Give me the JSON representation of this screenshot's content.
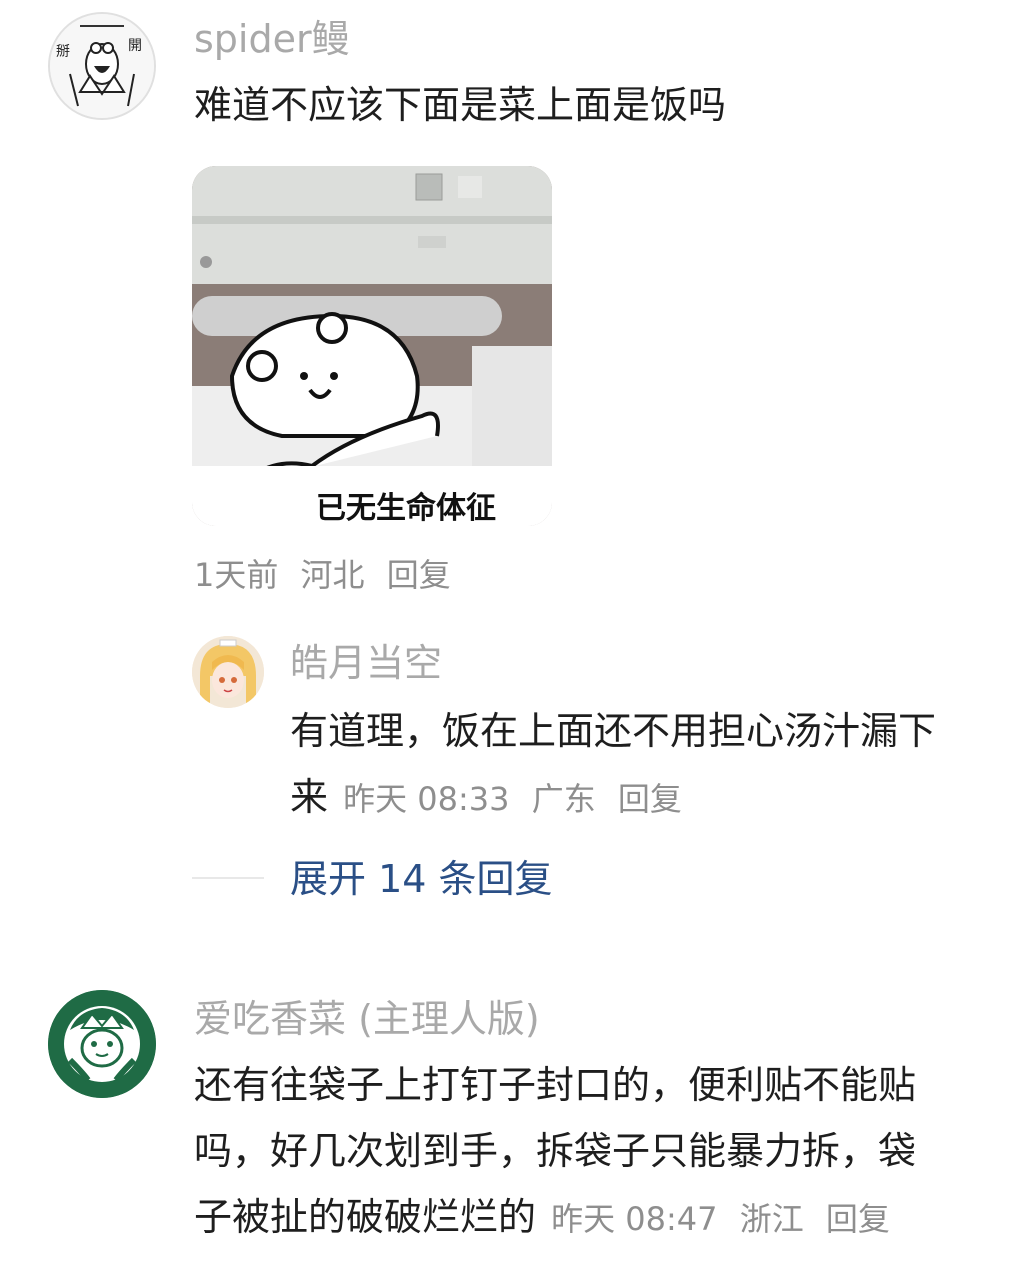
{
  "comments": [
    {
      "username": "spider鳗",
      "text": "难道不应该下面是菜上面是饭吗",
      "sticker_caption": "已无生命体征",
      "meta": {
        "time": "1天前",
        "location": "河北",
        "reply": "回复"
      },
      "avatar_text": {
        "left": "掰",
        "right": "開"
      },
      "replies": [
        {
          "username": "皓月当空",
          "text_line1": "有道理，饭在上面还不用担心汤汁漏下",
          "text_line2": "来",
          "meta": {
            "time": "昨天 08:33",
            "location": "广东",
            "reply": "回复"
          }
        }
      ],
      "expand_label": "展开 14 条回复"
    },
    {
      "username": "爱吃香菜 (主理人版)",
      "text_line1": "还有往袋子上打钉子封口的，便利贴不能贴",
      "text_line2": "吗，好几次划到手，拆袋子只能暴力拆，袋",
      "text_line3": "子被扯的破破烂烂的",
      "meta": {
        "time": "昨天 08:47",
        "location": "浙江",
        "reply": "回复"
      }
    }
  ],
  "colors": {
    "username": "#a9a9a9",
    "link": "#2a4f86",
    "meta": "#8e8e8e",
    "text": "#1e1e1e"
  },
  "icons": {
    "avatar1": "cartoon-face-avatar",
    "avatar2": "anime-girl-avatar",
    "avatar3": "starbucks-style-avatar"
  }
}
